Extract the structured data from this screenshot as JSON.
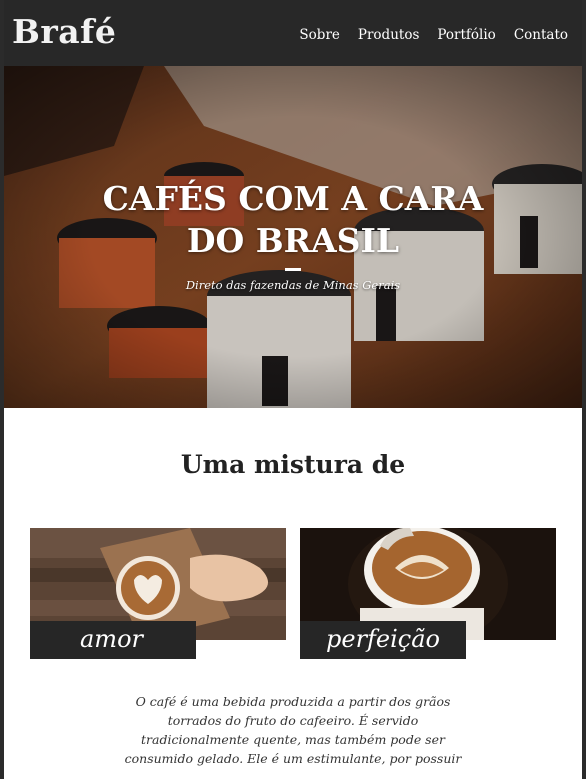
{
  "header": {
    "logo": "Brafé",
    "nav": [
      "Sobre",
      "Produtos",
      "Portfólio",
      "Contato"
    ]
  },
  "hero": {
    "title_line1": "CAFÉS COM A CARA",
    "title_line2": "DO BRASIL",
    "subtitle": "Direto das fazendas de Minas Gerais"
  },
  "section": {
    "title": "Uma mistura de",
    "card_left_label": "amor",
    "card_right_label": "perfeição",
    "body": "O café é uma bebida produzida a partir dos grãos torrados do fruto do cafeeiro. É servido tradicionalmente quente, mas também pode ser consumido gelado. Ele é um estimulante, por possuir"
  },
  "colors": {
    "header_bg": "#282828",
    "label_bg": "#262626",
    "text_dark": "#222222"
  }
}
